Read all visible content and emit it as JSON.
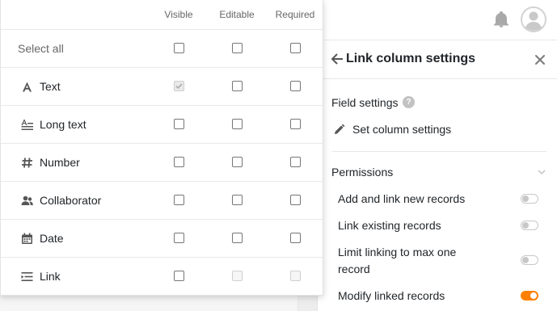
{
  "colors": {
    "accent": "#ff8000",
    "text": "#212529",
    "muted": "#666666",
    "divider": "#e9e9e9"
  },
  "topbar": {
    "icons": [
      "bell-icon",
      "user-avatar-icon"
    ]
  },
  "table": {
    "columns": [
      "Visible",
      "Editable",
      "Required"
    ],
    "rows": [
      {
        "label": "Select all",
        "icon": null,
        "visible": false,
        "editable": false,
        "required": false
      },
      {
        "label": "Text",
        "icon": "text-type-icon",
        "visible": true,
        "visible_disabled": true,
        "editable": false,
        "required": false
      },
      {
        "label": "Long text",
        "icon": "long-text-icon",
        "visible": false,
        "editable": false,
        "required": false
      },
      {
        "label": "Number",
        "icon": "number-icon",
        "visible": false,
        "editable": false,
        "required": false
      },
      {
        "label": "Collaborator",
        "icon": "collaborator-icon",
        "visible": false,
        "editable": false,
        "required": false
      },
      {
        "label": "Date",
        "icon": "calendar-icon",
        "visible": false,
        "editable": false,
        "required": false
      },
      {
        "label": "Link",
        "icon": "link-type-icon",
        "visible": false,
        "editable": false,
        "editable_disabled": true,
        "required": false,
        "required_disabled": true
      }
    ]
  },
  "panel": {
    "title": "Link column settings",
    "field_settings_label": "Field settings",
    "help_glyph": "?",
    "set_column_settings": "Set column settings",
    "permissions_label": "Permissions",
    "permissions": [
      {
        "label": "Add and link new records",
        "enabled": false
      },
      {
        "label": "Link existing records",
        "enabled": false
      },
      {
        "label": "Limit linking to max one record",
        "enabled": false
      },
      {
        "label": "Modify linked records",
        "enabled": true
      }
    ]
  }
}
